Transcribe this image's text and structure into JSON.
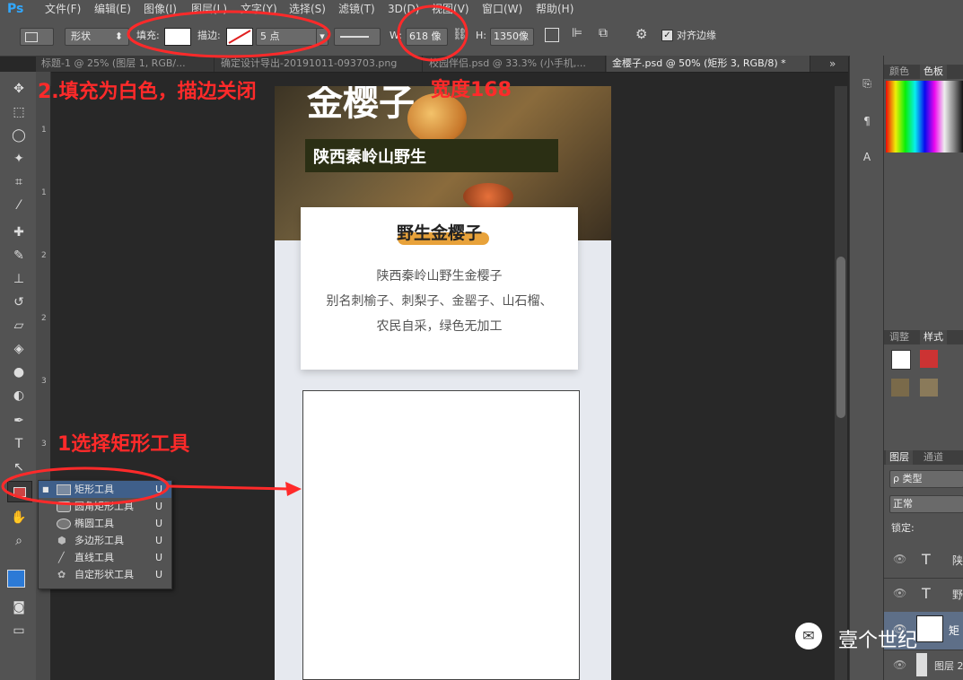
{
  "menu": {
    "logo": "Ps",
    "items": [
      "文件(F)",
      "编辑(E)",
      "图像(I)",
      "图层(L)",
      "文字(Y)",
      "选择(S)",
      "滤镜(T)",
      "3D(D)",
      "视图(V)",
      "窗口(W)",
      "帮助(H)"
    ]
  },
  "options": {
    "mode": "形状",
    "fill_label": "填充:",
    "stroke_label": "描边:",
    "stroke_size": "5 点",
    "w_label": "W:",
    "w_value": "618 像",
    "h_label": "H:",
    "h_value": "1350像",
    "align_edges": "对齐边缘"
  },
  "tabs": [
    "标题-1 @ 25% (图层 1, RGB/...",
    "确定设计导出-20191011-093703.png",
    "校园伴侣.psd @ 33.3% (小手机,...",
    "金樱子.psd @ 50% (矩形 3, RGB/8) *"
  ],
  "canvas": {
    "hero_title_partial": "金樱子",
    "hero_subtitle": "陕西秦岭山野生",
    "card_title": "野生金樱子",
    "card_lines": [
      "陕西秦岭山野生金樱子",
      "别名刺榆子、刺梨子、金罂子、山石榴、",
      "农民自采，绿色无加工"
    ]
  },
  "flyout": {
    "items": [
      {
        "label": "矩形工具",
        "key": "U",
        "icon": "rect-icon"
      },
      {
        "label": "圆角矩形工具",
        "key": "U",
        "icon": "rounded-rect-icon"
      },
      {
        "label": "椭圆工具",
        "key": "U",
        "icon": "ellipse-icon"
      },
      {
        "label": "多边形工具",
        "key": "U",
        "icon": "polygon-icon"
      },
      {
        "label": "直线工具",
        "key": "U",
        "icon": "line-icon"
      },
      {
        "label": "自定形状工具",
        "key": "U",
        "icon": "custom-shape-icon"
      }
    ]
  },
  "right_panel": {
    "swatch_tabs": [
      "颜色",
      "色板"
    ],
    "adjust_tabs": [
      "调整",
      "样式"
    ],
    "layer_tabs": [
      "图层",
      "通道"
    ],
    "kind": "ρ 类型",
    "blend": "正常",
    "lock": "锁定:",
    "layers": [
      "陕",
      "野",
      "矩",
      "图层 2"
    ]
  },
  "annotations": {
    "step1": "1选择矩形工具",
    "step2": "2.填充为白色，描边关闭",
    "width_note": "宽度168"
  },
  "watermark": "壹个世纪",
  "colors": {
    "accent": "#31a8ff",
    "annotation": "#ff2a2a",
    "highlight": "#e8a23a"
  }
}
